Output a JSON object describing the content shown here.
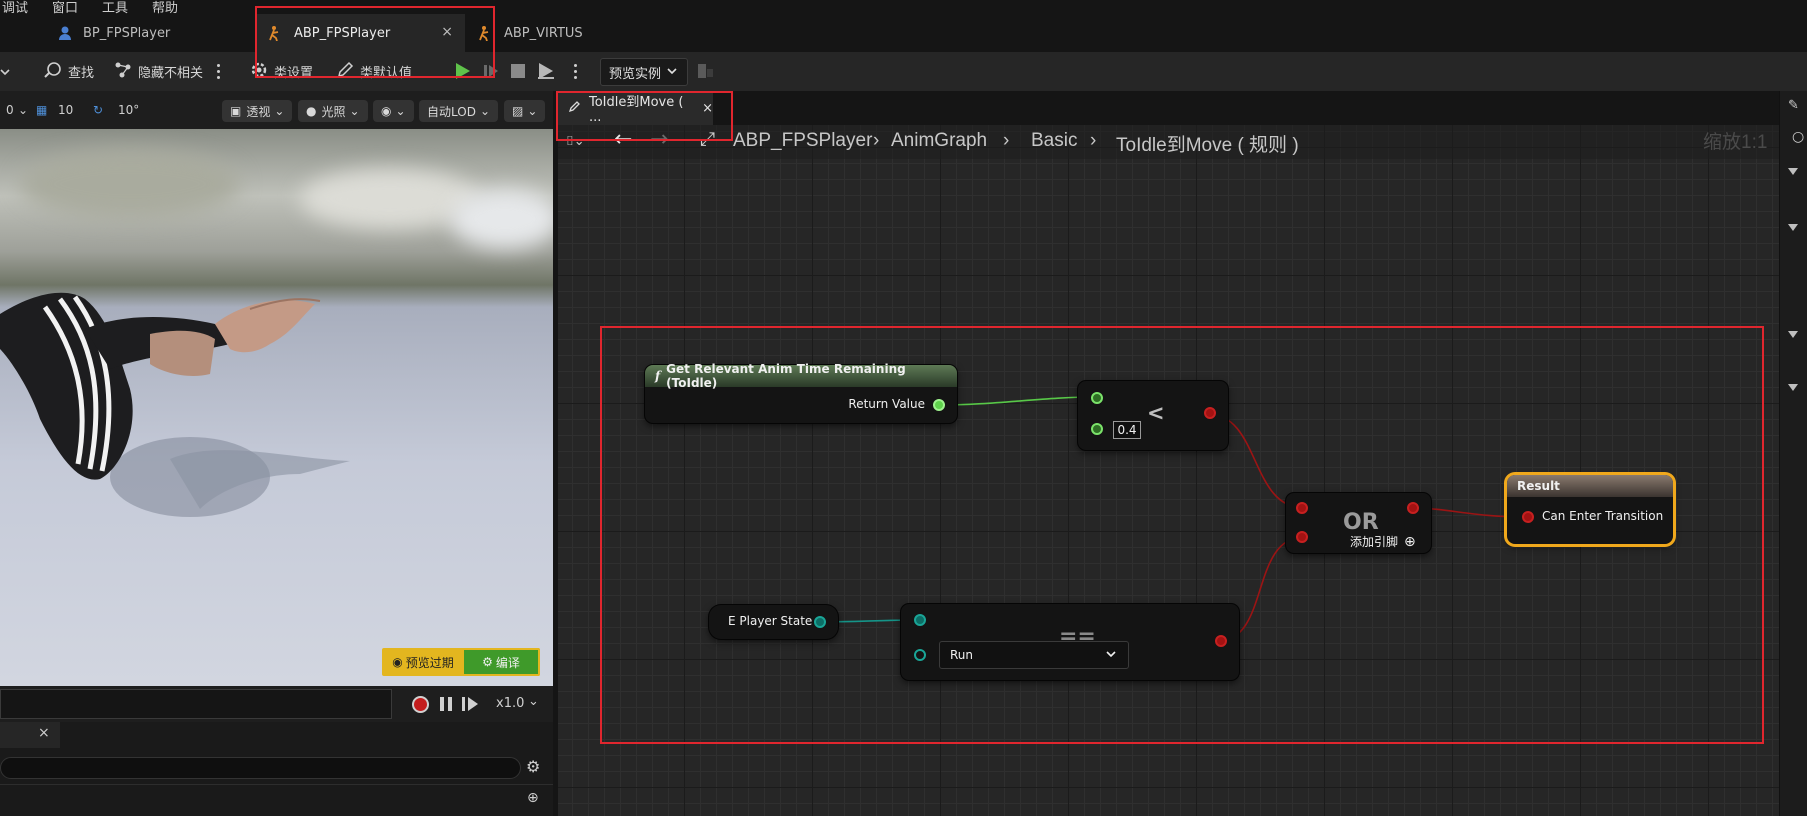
{
  "menu": [
    "调试",
    "窗口",
    "工具",
    "帮助"
  ],
  "doc_tabs": [
    {
      "label": "BP_FPSPlayer"
    },
    {
      "label": "ABP_FPSPlayer"
    },
    {
      "label": "ABP_VIRTUS"
    }
  ],
  "toolbar": {
    "find": "查找",
    "hide_unrelated": "隐藏不相关",
    "class_settings": "类设置",
    "class_defaults": "类默认值",
    "preview_instance": "预览实例"
  },
  "viewport": {
    "grid_snap": "10",
    "rot_snap": "10°",
    "perspective": "透视",
    "lit": "光照",
    "lod": "自动LOD",
    "leading_value": "0",
    "preview_stale": "预览过期",
    "compile": "编译",
    "speed": "x1.0"
  },
  "graph": {
    "tab_label": "ToIdle到Move ( ...",
    "breadcrumb": [
      "ABP_FPSPlayer",
      "AnimGraph",
      "Basic",
      "ToIdle到Move ( 规则 )"
    ],
    "zoom": "缩放1:1"
  },
  "nodes": {
    "get_anim": {
      "title": "Get Relevant Anim Time Remaining (ToIdle)",
      "output": "Return Value"
    },
    "less": {
      "symbol": "<",
      "value": "0.4"
    },
    "or": {
      "title": "OR",
      "add_pin": "添加引脚"
    },
    "equal": {
      "symbol": "==",
      "option": "Run"
    },
    "player_state": {
      "label": "E Player State"
    },
    "result": {
      "title": "Result",
      "input": "Can Enter Transition"
    }
  },
  "colors": {
    "accent_red": "#e0262e",
    "exec_green": "#5fd34c",
    "bool_red": "#a31212",
    "enum_teal": "#1aa597",
    "result_orange": "#f0a81c"
  }
}
